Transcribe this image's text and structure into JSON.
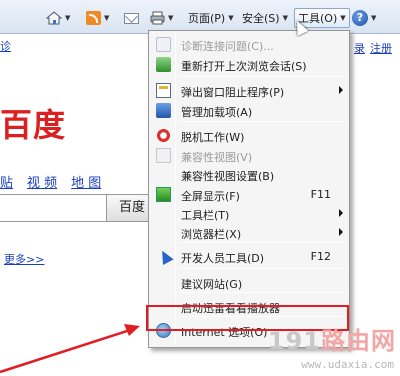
{
  "toolbar": {
    "page_menu": "页面(P)",
    "safety_menu": "安全(S)",
    "tools_menu": "工具(O)",
    "help": "?"
  },
  "webpage": {
    "top_right_links": [
      "录",
      "注册"
    ],
    "top_left_link": "诊",
    "logo_text": "百度",
    "nav_links": [
      "贴",
      "视 频",
      "地 图"
    ],
    "search_button": "百度",
    "more_link": "更多>>"
  },
  "menu": {
    "items": [
      {
        "label": "诊断连接问题(C)...",
        "shortcut": "",
        "disabled": true,
        "submenu": false,
        "icon": "diagnose-icon"
      },
      {
        "label": "重新打开上次浏览会话(S)",
        "shortcut": "",
        "disabled": false,
        "submenu": false,
        "icon": "reopen-session-icon"
      },
      {
        "label": "弹出窗口阻止程序(P)",
        "shortcut": "",
        "disabled": false,
        "submenu": true,
        "icon": "popup-blocker-icon"
      },
      {
        "label": "管理加载项(A)",
        "shortcut": "",
        "disabled": false,
        "submenu": false,
        "icon": "addons-icon"
      },
      {
        "label": "脱机工作(W)",
        "shortcut": "",
        "disabled": false,
        "submenu": false,
        "icon": "offline-icon"
      },
      {
        "label": "兼容性视图(V)",
        "shortcut": "",
        "disabled": true,
        "submenu": false,
        "icon": "compat-view-icon"
      },
      {
        "label": "兼容性视图设置(B)",
        "shortcut": "",
        "disabled": false,
        "submenu": false,
        "icon": ""
      },
      {
        "label": "全屏显示(F)",
        "shortcut": "F11",
        "disabled": false,
        "submenu": false,
        "icon": "fullscreen-icon"
      },
      {
        "label": "工具栏(T)",
        "shortcut": "",
        "disabled": false,
        "submenu": true,
        "icon": ""
      },
      {
        "label": "浏览器栏(X)",
        "shortcut": "",
        "disabled": false,
        "submenu": true,
        "icon": ""
      },
      {
        "label": "开发人员工具(D)",
        "shortcut": "F12",
        "disabled": false,
        "submenu": false,
        "icon": "developer-tools-icon"
      },
      {
        "label": "建议网站(G)",
        "shortcut": "",
        "disabled": false,
        "submenu": false,
        "icon": ""
      },
      {
        "label": "启动迅雷看看播放器",
        "shortcut": "",
        "disabled": false,
        "submenu": false,
        "icon": ""
      },
      {
        "label": "Internet 选项(O)",
        "shortcut": "",
        "disabled": false,
        "submenu": false,
        "icon": "internet-options-icon"
      }
    ]
  },
  "watermark": {
    "text_gray": "191",
    "text_red": "路由网",
    "url": "www.udaxia.com"
  },
  "colors": {
    "highlight": "#e11d24",
    "link": "#1a3dbe",
    "logo": "#dd1f1f"
  }
}
